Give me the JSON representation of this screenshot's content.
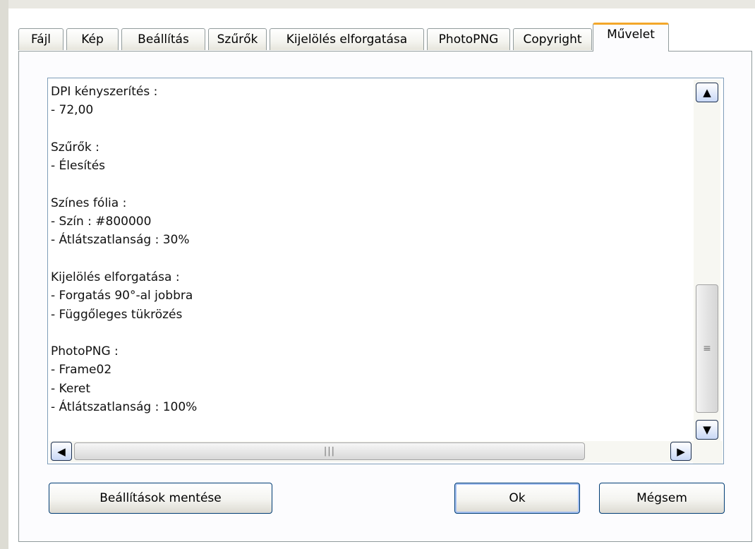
{
  "tabs": [
    {
      "label": "Fájl",
      "active": false
    },
    {
      "label": "Kép",
      "active": false
    },
    {
      "label": "Beállítás",
      "active": false
    },
    {
      "label": "Szűrők",
      "active": false
    },
    {
      "label": "Kijelölés elforgatása",
      "active": false
    },
    {
      "label": "PhotoPNG",
      "active": false
    },
    {
      "label": "Copyright",
      "active": false
    },
    {
      "label": "Művelet",
      "active": true
    }
  ],
  "summary_lines": [
    "DPI kényszerítés :",
    "- 72,00",
    "",
    "Szűrők :",
    "- Élesítés",
    "",
    "Színes fólia :",
    "- Szín : #800000",
    "- Átlátszatlanság : 30%",
    "",
    "Kijelölés elforgatása :",
    "- Forgatás 90°-al jobbra",
    "- Függőleges tükrözés",
    "",
    "PhotoPNG :",
    "- Frame02",
    "- Keret",
    "- Átlátszatlanság : 100%"
  ],
  "buttons": {
    "save_settings": "Beállítások mentése",
    "ok": "Ok",
    "cancel": "Mégsem"
  },
  "colors": {
    "active_tab_accent": "#f3a72a",
    "button_border": "#003c74"
  }
}
